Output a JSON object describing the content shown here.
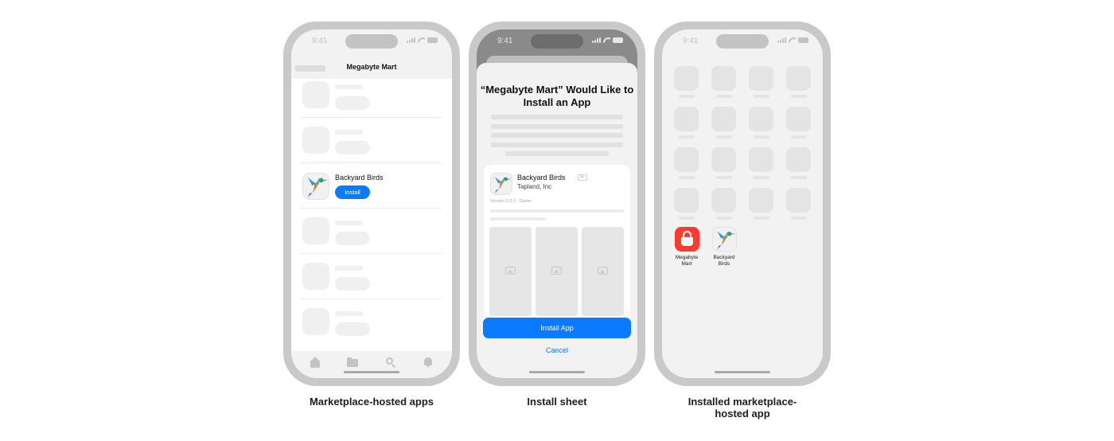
{
  "status_time": "9:41",
  "phone1": {
    "nav_title": "Megabyte Mart",
    "featured_app": {
      "name": "Backyard Birds",
      "install_label": "Install"
    },
    "tab_icons": [
      "home-icon",
      "folder-icon",
      "search-icon",
      "bell-icon"
    ],
    "caption": "Marketplace-hosted apps"
  },
  "phone2": {
    "sheet_title": "“Megabyte Mart” Would Like to Install an App",
    "app_name": "Backyard Birds",
    "developer": "Tapland, Inc",
    "age_rating": "4+",
    "version_info": "Version 5.5.0 · Game",
    "install_button": "Install App",
    "cancel_button": "Cancel",
    "caption": "Install sheet"
  },
  "phone3": {
    "apps": [
      {
        "label": "Megabyte\nMart",
        "icon": "shopping-basket-icon",
        "color": "#ff3b30"
      },
      {
        "label": "Backyard\nBirds",
        "icon": "hummingbird-icon"
      }
    ],
    "caption": "Installed marketplace-\nhosted app"
  },
  "colors": {
    "accent": "#0a7aff",
    "frame": "#c9c9c9",
    "placeholder": "#f0f0f0"
  }
}
